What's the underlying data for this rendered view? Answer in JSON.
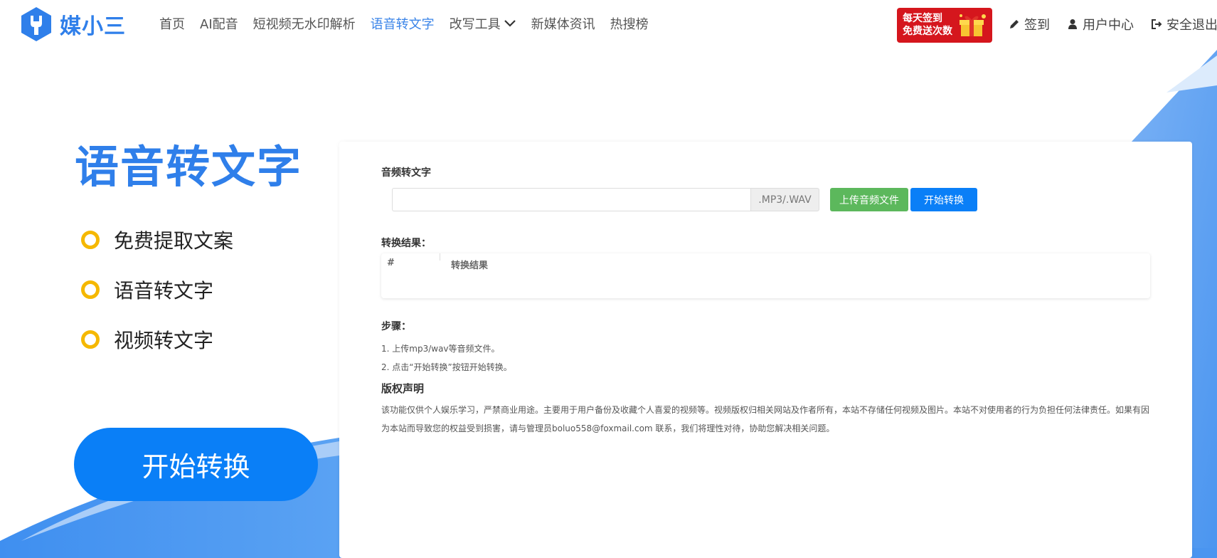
{
  "brand": {
    "name": "媒小三"
  },
  "nav": [
    {
      "label": "首页"
    },
    {
      "label": "AI配音"
    },
    {
      "label": "短视频无水印解析"
    },
    {
      "label": "语音转文字",
      "active": true
    },
    {
      "label": "改写工具",
      "has_dropdown": true
    },
    {
      "label": "新媒体资讯"
    },
    {
      "label": "热搜榜"
    }
  ],
  "promo": {
    "line1": "每天签到",
    "line2": "免费送次数",
    "icon": "gift-box-icon"
  },
  "user_links": {
    "signin": {
      "label": "签到",
      "icon": "pencil-icon"
    },
    "user_center": {
      "label": "用户中心",
      "icon": "user-icon"
    },
    "logout": {
      "label": "安全退出",
      "icon": "sign-out-icon"
    }
  },
  "hero": {
    "title": "语音转文字",
    "features": [
      "免费提取文案",
      "语音转文字",
      "视频转文字"
    ],
    "button_label": "开始转换"
  },
  "panel": {
    "audio_label": "音频转文字",
    "file_input_value": "",
    "file_suffix": ".MP3/.WAV",
    "upload_button": "上传音频文件",
    "start_button": "开始转换",
    "result_label": "转换结果：",
    "result_table": {
      "columns": [
        "#",
        "转换结果"
      ],
      "rows": []
    },
    "steps_label": "步骤：",
    "steps": [
      "1. 上传mp3/wav等音频文件。",
      "2. 点击“开始转换”按钮开始转换。"
    ],
    "copyright_label": "版权声明",
    "copyright_text": "该功能仅供个人娱乐学习，严禁商业用途。主要用于用户备份及收藏个人喜爱的视频等。视频版权归相关网站及作者所有，本站不存储任何视频及图片。本站不对使用者的行为负担任何法律责任。如果有因为本站而导致您的权益受到损害，请与管理员boluo558@foxmail.com 联系，我们将理性对待，协助您解决相关问题。"
  },
  "colors": {
    "brand_blue": "#2f7fea",
    "primary_button": "#0a7ff7",
    "success_button": "#5cb85c",
    "promo_red": "#d5161d",
    "feature_ring": "#f5b800",
    "nav_active": "#3a84e8"
  }
}
